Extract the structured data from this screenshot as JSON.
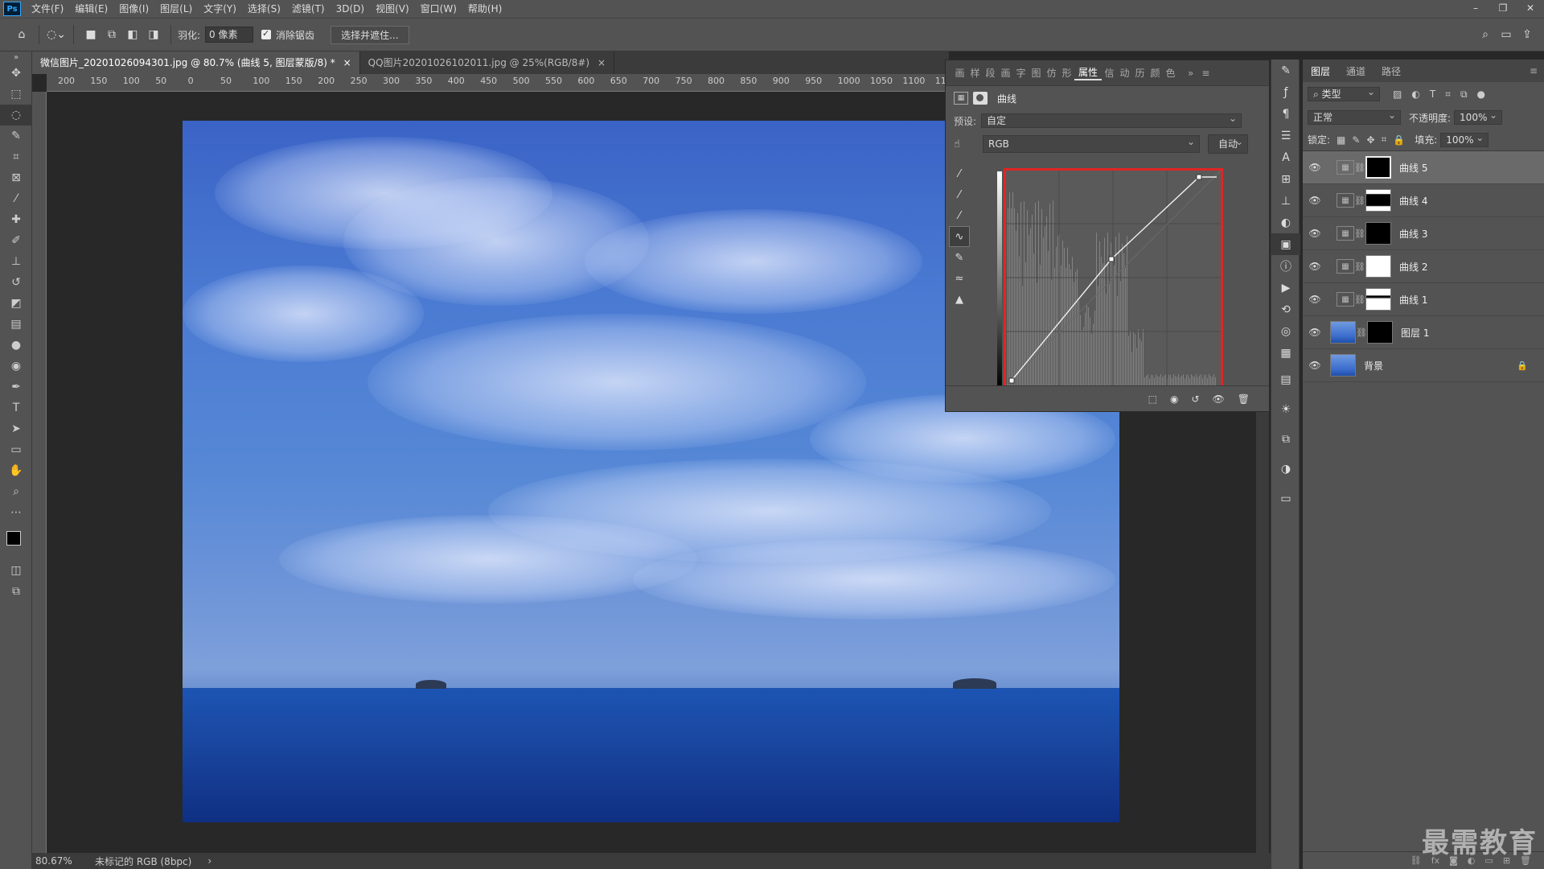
{
  "menu": {
    "items": [
      "文件(F)",
      "编辑(E)",
      "图像(I)",
      "图层(L)",
      "文字(Y)",
      "选择(S)",
      "滤镜(T)",
      "3D(D)",
      "视图(V)",
      "窗口(W)",
      "帮助(H)"
    ],
    "logo": "Ps"
  },
  "options": {
    "feather_label": "羽化:",
    "feather_value": "0 像素",
    "antialias_label": "消除锯齿",
    "select_mask_button": "选择并遮住..."
  },
  "tabs": [
    {
      "label": "微信图片_20201026094301.jpg @ 80.7% (曲线 5, 图层蒙版/8) *",
      "close": "×"
    },
    {
      "label": "QQ图片20201026102011.jpg @ 25%(RGB/8#)",
      "close": "×"
    }
  ],
  "ruler": {
    "labels": [
      "200",
      "150",
      "100",
      "50",
      "0",
      "50",
      "100",
      "150",
      "200",
      "250",
      "300",
      "350",
      "400",
      "450",
      "500",
      "550",
      "600",
      "650",
      "700",
      "750",
      "800",
      "850",
      "900",
      "950",
      "1000",
      "1050",
      "1100",
      "11"
    ]
  },
  "status": {
    "zoom": "80.67%",
    "doc_info": "未标记的 RGB (8bpc)",
    "arrow": "›"
  },
  "properties": {
    "tabs": [
      "画",
      "样",
      "段",
      "画",
      "字",
      "图",
      "仿",
      "形",
      "属性",
      "信",
      "动",
      "历",
      "颜",
      "色"
    ],
    "active_tab": "属性",
    "panel_title": "曲线",
    "preset_label": "预设:",
    "preset_value": "自定",
    "channel_value": "RGB",
    "auto_button": "自动"
  },
  "layers": {
    "tabs": [
      "图层",
      "通道",
      "路径"
    ],
    "filter_label": "类型",
    "blend_mode": "正常",
    "opacity_label": "不透明度:",
    "opacity_value": "100%",
    "lock_label": "锁定:",
    "fill_label": "填充:",
    "fill_value": "100%",
    "items": [
      {
        "name": "曲线 5",
        "selected": true
      },
      {
        "name": "曲线 4",
        "selected": false
      },
      {
        "name": "曲线 3",
        "selected": false
      },
      {
        "name": "曲线 2",
        "selected": false
      },
      {
        "name": "曲线 1",
        "selected": false
      },
      {
        "name": "图层 1",
        "selected": false
      },
      {
        "name": "背景",
        "selected": false
      }
    ]
  },
  "watermark": "最需教育"
}
